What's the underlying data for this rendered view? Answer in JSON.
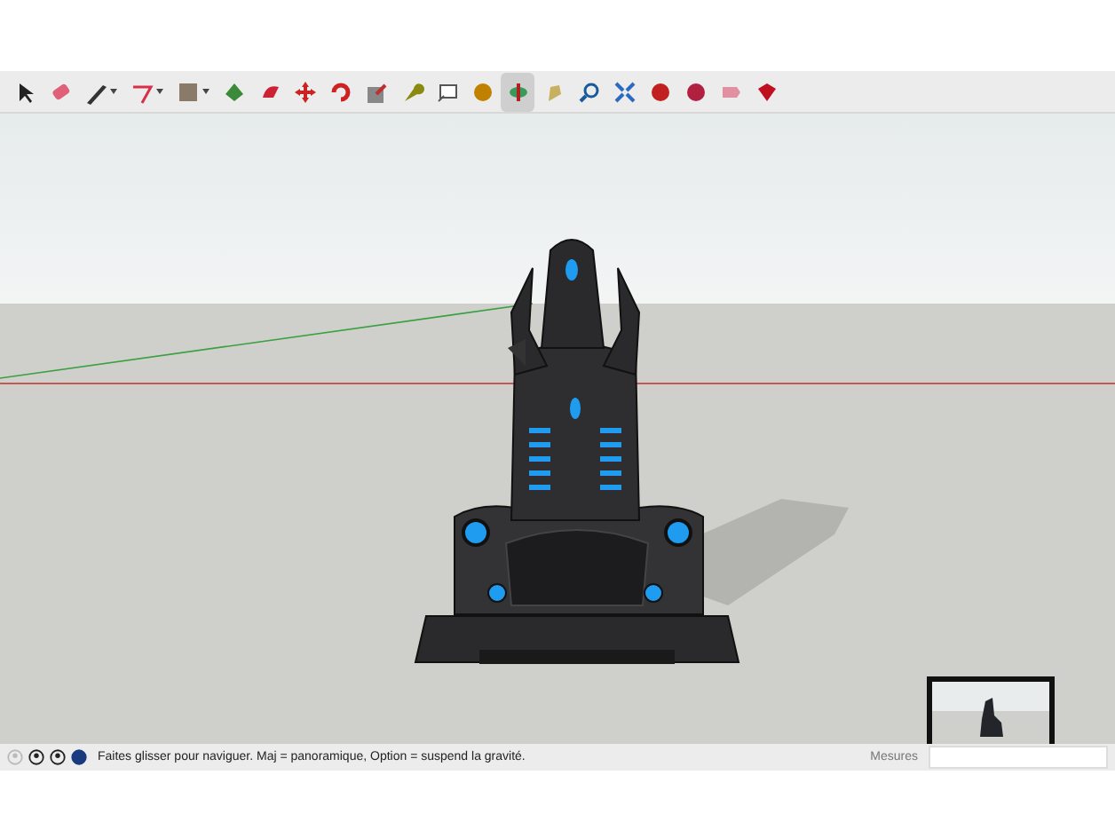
{
  "toolbar": {
    "tools": [
      {
        "selected": false,
        "dropdown": false
      },
      {
        "selected": false,
        "dropdown": false
      },
      {
        "selected": false,
        "dropdown": true
      },
      {
        "selected": false,
        "dropdown": true
      },
      {
        "selected": false,
        "dropdown": true
      },
      {
        "selected": false,
        "dropdown": false
      },
      {
        "selected": false,
        "dropdown": false
      },
      {
        "selected": false,
        "dropdown": false
      },
      {
        "selected": false,
        "dropdown": false
      },
      {
        "selected": false,
        "dropdown": false
      },
      {
        "selected": false,
        "dropdown": false
      },
      {
        "selected": false,
        "dropdown": false
      },
      {
        "selected": false,
        "dropdown": false
      },
      {
        "selected": true,
        "dropdown": false
      },
      {
        "selected": false,
        "dropdown": false
      },
      {
        "selected": false,
        "dropdown": false
      },
      {
        "selected": false,
        "dropdown": false
      },
      {
        "selected": false,
        "dropdown": false
      },
      {
        "selected": false,
        "dropdown": false
      },
      {
        "selected": false,
        "dropdown": false
      },
      {
        "selected": false,
        "dropdown": false
      }
    ]
  },
  "status_bar": {
    "hint": "Faites glisser pour naviguer. Maj = panoramique, Option =  suspend la gravité.",
    "measurements_label": "Mesures"
  }
}
